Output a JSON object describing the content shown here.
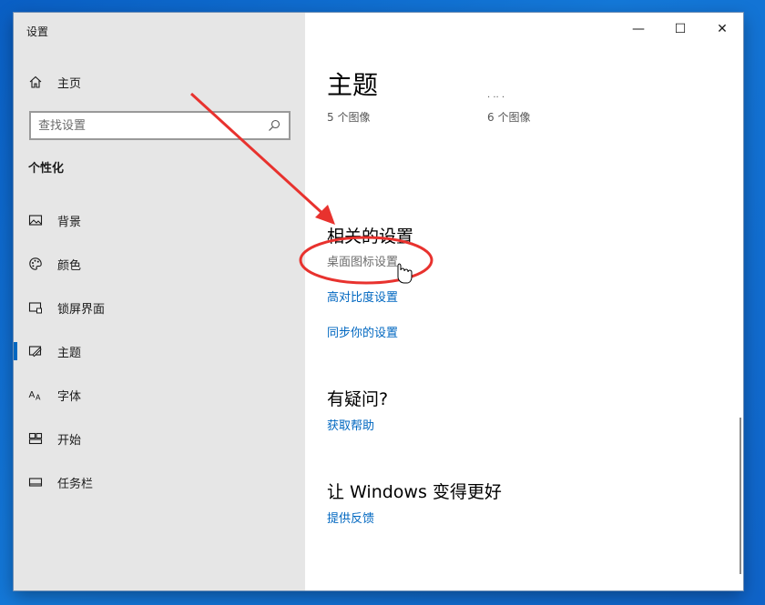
{
  "window": {
    "title": "设置",
    "controls": {
      "minimize": "—",
      "maximize": "☐",
      "close": "✕"
    }
  },
  "sidebar": {
    "home_label": "主页",
    "search_placeholder": "查找设置",
    "section_title": "个性化",
    "items": [
      {
        "label": "背景",
        "icon": "background-image-icon"
      },
      {
        "label": "颜色",
        "icon": "palette-icon"
      },
      {
        "label": "锁屏界面",
        "icon": "lock-screen-icon"
      },
      {
        "label": "主题",
        "icon": "theme-brush-icon",
        "active": true
      },
      {
        "label": "字体",
        "icon": "font-icon"
      },
      {
        "label": "开始",
        "icon": "start-tiles-icon"
      },
      {
        "label": "任务栏",
        "icon": "taskbar-icon"
      }
    ]
  },
  "main": {
    "page_title": "主题",
    "theme_captions": [
      "5 个图像",
      "6 个图像"
    ],
    "related": {
      "heading": "相关的设置",
      "links": [
        "桌面图标设置",
        "高对比度设置",
        "同步你的设置"
      ]
    },
    "question": {
      "heading": "有疑问?",
      "link": "获取帮助"
    },
    "improve": {
      "heading": "让 Windows 变得更好",
      "link": "提供反馈"
    }
  },
  "annotation": {
    "color": "#e8322e"
  }
}
